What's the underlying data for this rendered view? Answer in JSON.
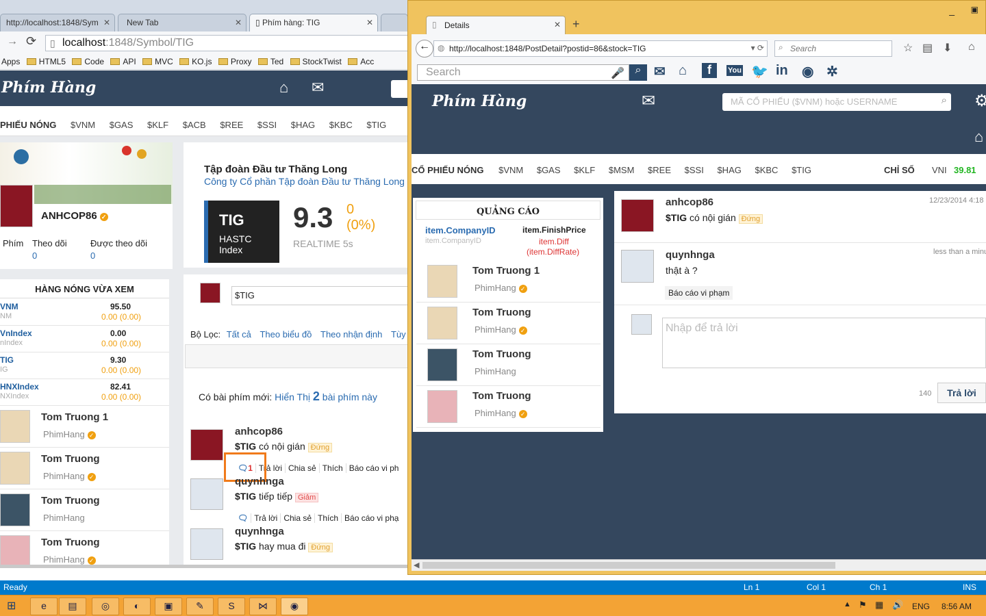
{
  "chrome": {
    "tabs": [
      "http://localhost:1848/Sym",
      "New Tab",
      "Phím hàng: TIG"
    ],
    "url_host": "localhost",
    "url_rest": ":1848/Symbol/TIG",
    "bookmarks": [
      "Apps",
      "HTML5",
      "Code",
      "API",
      "MVC",
      "KO.js",
      "Proxy",
      "Ted",
      "StockTwist",
      "Acc"
    ]
  },
  "site": {
    "logo": "Phím Hàng",
    "hot_label": "PHIẾU NÓNG",
    "tickers": [
      "$VNM",
      "$GAS",
      "$KLF",
      "$ACB",
      "$REE",
      "$SSI",
      "$HAG",
      "$KBC",
      "$TIG"
    ],
    "profile": {
      "name": "ANHCOP86",
      "stats": [
        {
          "label": "Phím",
          "value": ""
        },
        {
          "label": "Theo dõi",
          "value": "0"
        },
        {
          "label": "Được theo dõi",
          "value": "0"
        }
      ]
    },
    "watchlist_title": "HÀNG NÓNG VỪA XEM",
    "watchlist": [
      {
        "code": "VNM",
        "sub": "NM",
        "price": "95.50",
        "change": "0.00 (0.00)"
      },
      {
        "code": "VnIndex",
        "sub": "nIndex",
        "price": "0.00",
        "change": "0.00 (0.00)"
      },
      {
        "code": "TIG",
        "sub": "IG",
        "price": "9.30",
        "change": "0.00 (0.00)"
      },
      {
        "code": "HNXIndex",
        "sub": "NXIndex",
        "price": "82.41",
        "change": "0.00 (0.00)"
      }
    ],
    "users": [
      {
        "name": "Tom Truong 1",
        "handle": "PhimHang",
        "verified": true
      },
      {
        "name": "Tom Truong",
        "handle": "PhimHang",
        "verified": true
      },
      {
        "name": "Tom Truong",
        "handle": "PhimHang",
        "verified": false
      },
      {
        "name": "Tom Truong",
        "handle": "PhimHang",
        "verified": true
      }
    ],
    "company": {
      "name": "Tập đoàn Đầu tư Thăng Long",
      "full": "Công ty Cổ phần Tập đoàn Đầu tư Thăng Long",
      "code": "TIG",
      "exchange": "HASTC",
      "type": "Index",
      "price": "9.3",
      "change": "0",
      "pct": "(0%)",
      "realtime": "REALTIME 5s"
    },
    "compose_value": "$TIG",
    "filter": {
      "label": "Bộ Lọc:",
      "items": [
        "Tất cả",
        "Theo biểu đồ",
        "Theo nhận định",
        "Tùy"
      ]
    },
    "new_posts": {
      "text": "Có bài phím mới:",
      "link": "Hiển Thị",
      "count": "2",
      "suffix": "bài phím này"
    },
    "posts": [
      {
        "user": "anhcop86",
        "text": "có nội gián",
        "ticker": "$TIG",
        "tag": "Đứng",
        "tagtype": "dung",
        "actions": [
          "1",
          "Trả lời",
          "Chia sẻ",
          "Thích",
          "Báo cáo vi ph"
        ]
      },
      {
        "user": "quynhnga",
        "text": "tiếp tiếp",
        "ticker": "$TIG",
        "tag": "Giảm",
        "tagtype": "giam",
        "actions": [
          "",
          "Trả lời",
          "Chia sẻ",
          "Thích",
          "Báo cáo vi phạ"
        ]
      },
      {
        "user": "quynhnga",
        "text": "hay mua đi",
        "ticker": "$TIG",
        "tag": "Đứng",
        "tagtype": "dung",
        "actions": []
      }
    ]
  },
  "firefox": {
    "tab": "Details",
    "url": "http://localhost:1848/PostDetail?postid=86&stock=TIG",
    "search_placeholder": "Search",
    "page_search": "Search",
    "site_search_placeholder": "MÃ CỔ PHIẾU ($VNM) hoặc USERNAME",
    "hot_label": "CỔ PHIẾU NÓNG",
    "tickers": [
      "$VNM",
      "$GAS",
      "$KLF",
      "$MSM",
      "$REE",
      "$SSI",
      "$HAG",
      "$KBC",
      "$TIG"
    ],
    "index_label": "CHỈ SỐ",
    "index_name": "VNI",
    "index_value": "39.81",
    "ad_title": "QUẢNG CÁO",
    "ad_item": {
      "company": "item.CompanyID",
      "company2": "item.CompanyID",
      "price": "item.FinishPrice",
      "diff": "item.Diff",
      "rate": "(item.DiffRate)"
    },
    "post": {
      "user": "anhcop86",
      "ticker": "$TIG",
      "text": "có nội gián",
      "tag": "Đứng",
      "time": "12/23/2014 4:18"
    },
    "reply": {
      "user": "quynhnga",
      "text": "thật à ?",
      "time": "less than a minu",
      "report": "Báo cáo vi phạm"
    },
    "reply_placeholder": "Nhập để trả lời",
    "char_count": "140",
    "reply_button": "Trả lời"
  },
  "status": {
    "ready": "Ready",
    "ln": "Ln 1",
    "col": "Col 1",
    "ch": "Ch 1",
    "ins": "INS"
  },
  "tray": {
    "lang": "ENG",
    "time": "8:56 AM"
  }
}
